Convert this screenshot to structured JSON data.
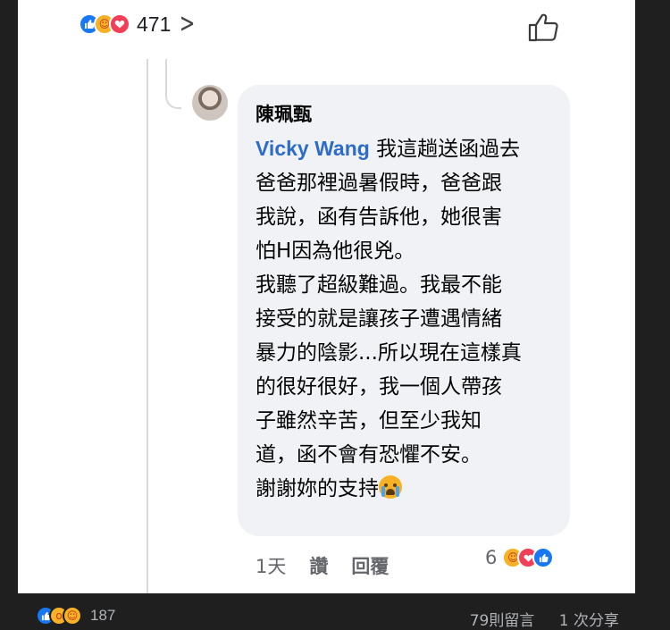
{
  "post": {
    "reaction_count": "471",
    "reaction_icons": [
      "like-icon",
      "care-icon",
      "love-icon"
    ]
  },
  "comment": {
    "author": "陳珮甄",
    "mention": "Vicky Wang",
    "lines": [
      " 我這趟送函過去",
      "爸爸那裡過暑假時，爸爸跟",
      "我說，函有告訴他，她很害",
      "怕H因為他很兇。",
      "我聽了超級難過。我最不能",
      "接受的就是讓孩子遭遇情緒",
      "暴力的陰影...所以現在這樣真",
      "的很好很好，我一個人帶孩",
      "子雖然辛苦，但至少我知",
      "道，函不會有恐懼不安。",
      "謝謝妳的支持"
    ],
    "time": "1天",
    "like_label": "讚",
    "reply_label": "回覆",
    "reaction_count": "6"
  },
  "footer": {
    "reaction_count": "187",
    "comments_label": "79則留言",
    "shares_label": "1 次分享"
  },
  "colors": {
    "like": "#1877f2",
    "love": "#f33e58",
    "care": "#f7b125",
    "mention": "#2d6cc8",
    "bubble": "#f0f2f5"
  }
}
